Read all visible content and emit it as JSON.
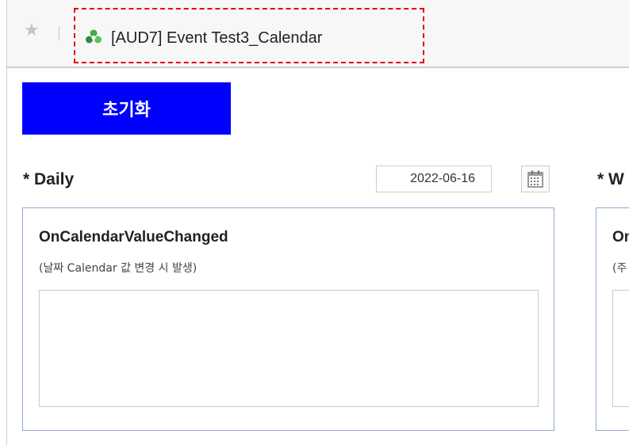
{
  "window": {
    "title": "[AUD7] Event Test3_Calendar",
    "star_icon": "star-icon",
    "app_icon": "app-logo-icon",
    "highlight_color": "#e60000"
  },
  "toolbar": {
    "reset_label": "초기화",
    "reset_color": "#0000ff"
  },
  "daily": {
    "section_title": "* Daily",
    "date_value": "2022-06-16",
    "calendar_icon": "calendar-icon",
    "event_title": "OnCalendarValueChanged",
    "event_desc": "(날짜 Calendar 값 변경 시 발생)",
    "log": ""
  },
  "weekly": {
    "section_title": "* W",
    "event_title": "On",
    "event_desc": "(주",
    "log": ""
  }
}
